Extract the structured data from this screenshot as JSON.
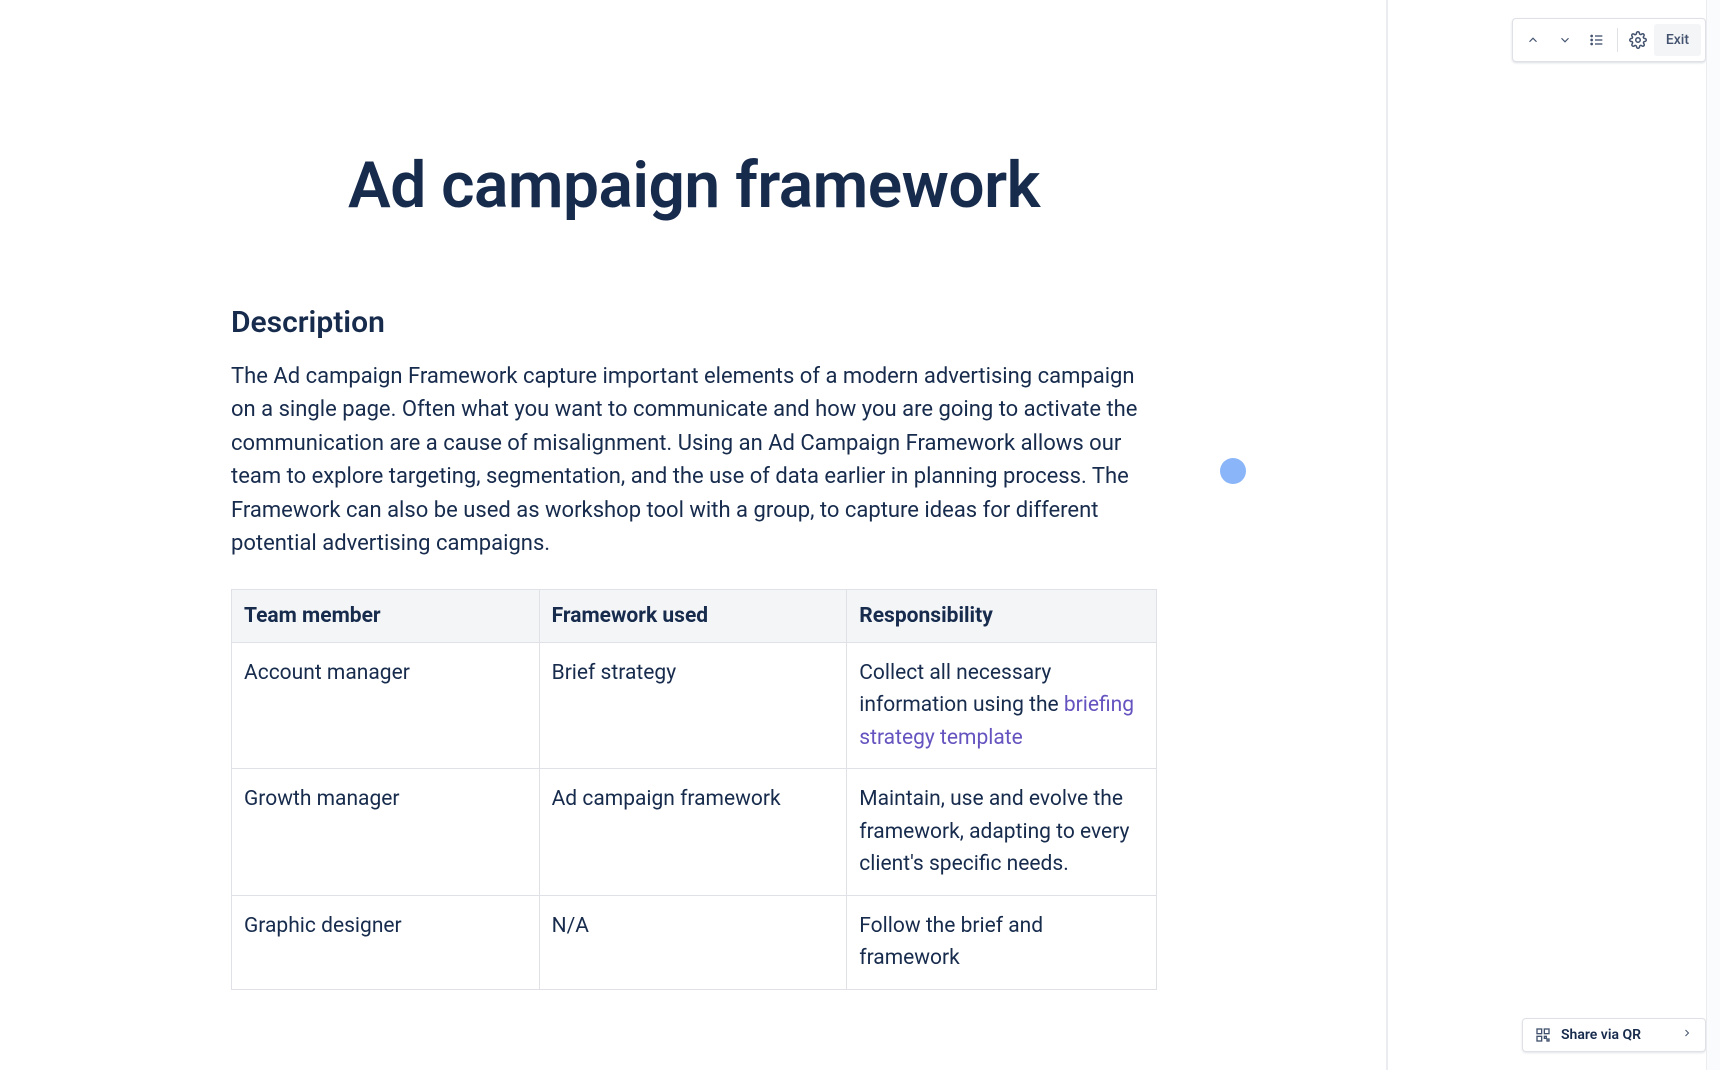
{
  "toolbar": {
    "exit_label": "Exit"
  },
  "share": {
    "label": "Share via QR"
  },
  "page": {
    "title": "Ad campaign framework",
    "description_heading": "Description",
    "description_body": "The Ad campaign Framework capture important elements of a modern advertising campaign on a single page.  Often what you want to communicate and how you are going to activate the communication are a cause of misalignment.  Using an Ad Campaign Framework allows our team to explore targeting, segmentation, and the use of data earlier in planning process.  The Framework can also be used as workshop tool with a group, to capture ideas for different potential advertising campaigns."
  },
  "table": {
    "headers": {
      "member": "Team member",
      "framework": "Framework used",
      "responsibility": "Responsibility"
    },
    "rows": [
      {
        "member": "Account manager",
        "framework": "Brief strategy",
        "responsibility_prefix": "Collect all necessary information using the ",
        "responsibility_link": "briefing strategy template",
        "responsibility_suffix": ""
      },
      {
        "member": "Growth manager",
        "framework": "Ad campaign framework",
        "responsibility_prefix": "Maintain, use and evolve the framework, adapting to every client's specific needs.",
        "responsibility_link": "",
        "responsibility_suffix": ""
      },
      {
        "member": "Graphic designer",
        "framework": "N/A",
        "responsibility_prefix": "Follow the brief and framework",
        "responsibility_link": "",
        "responsibility_suffix": ""
      }
    ]
  }
}
